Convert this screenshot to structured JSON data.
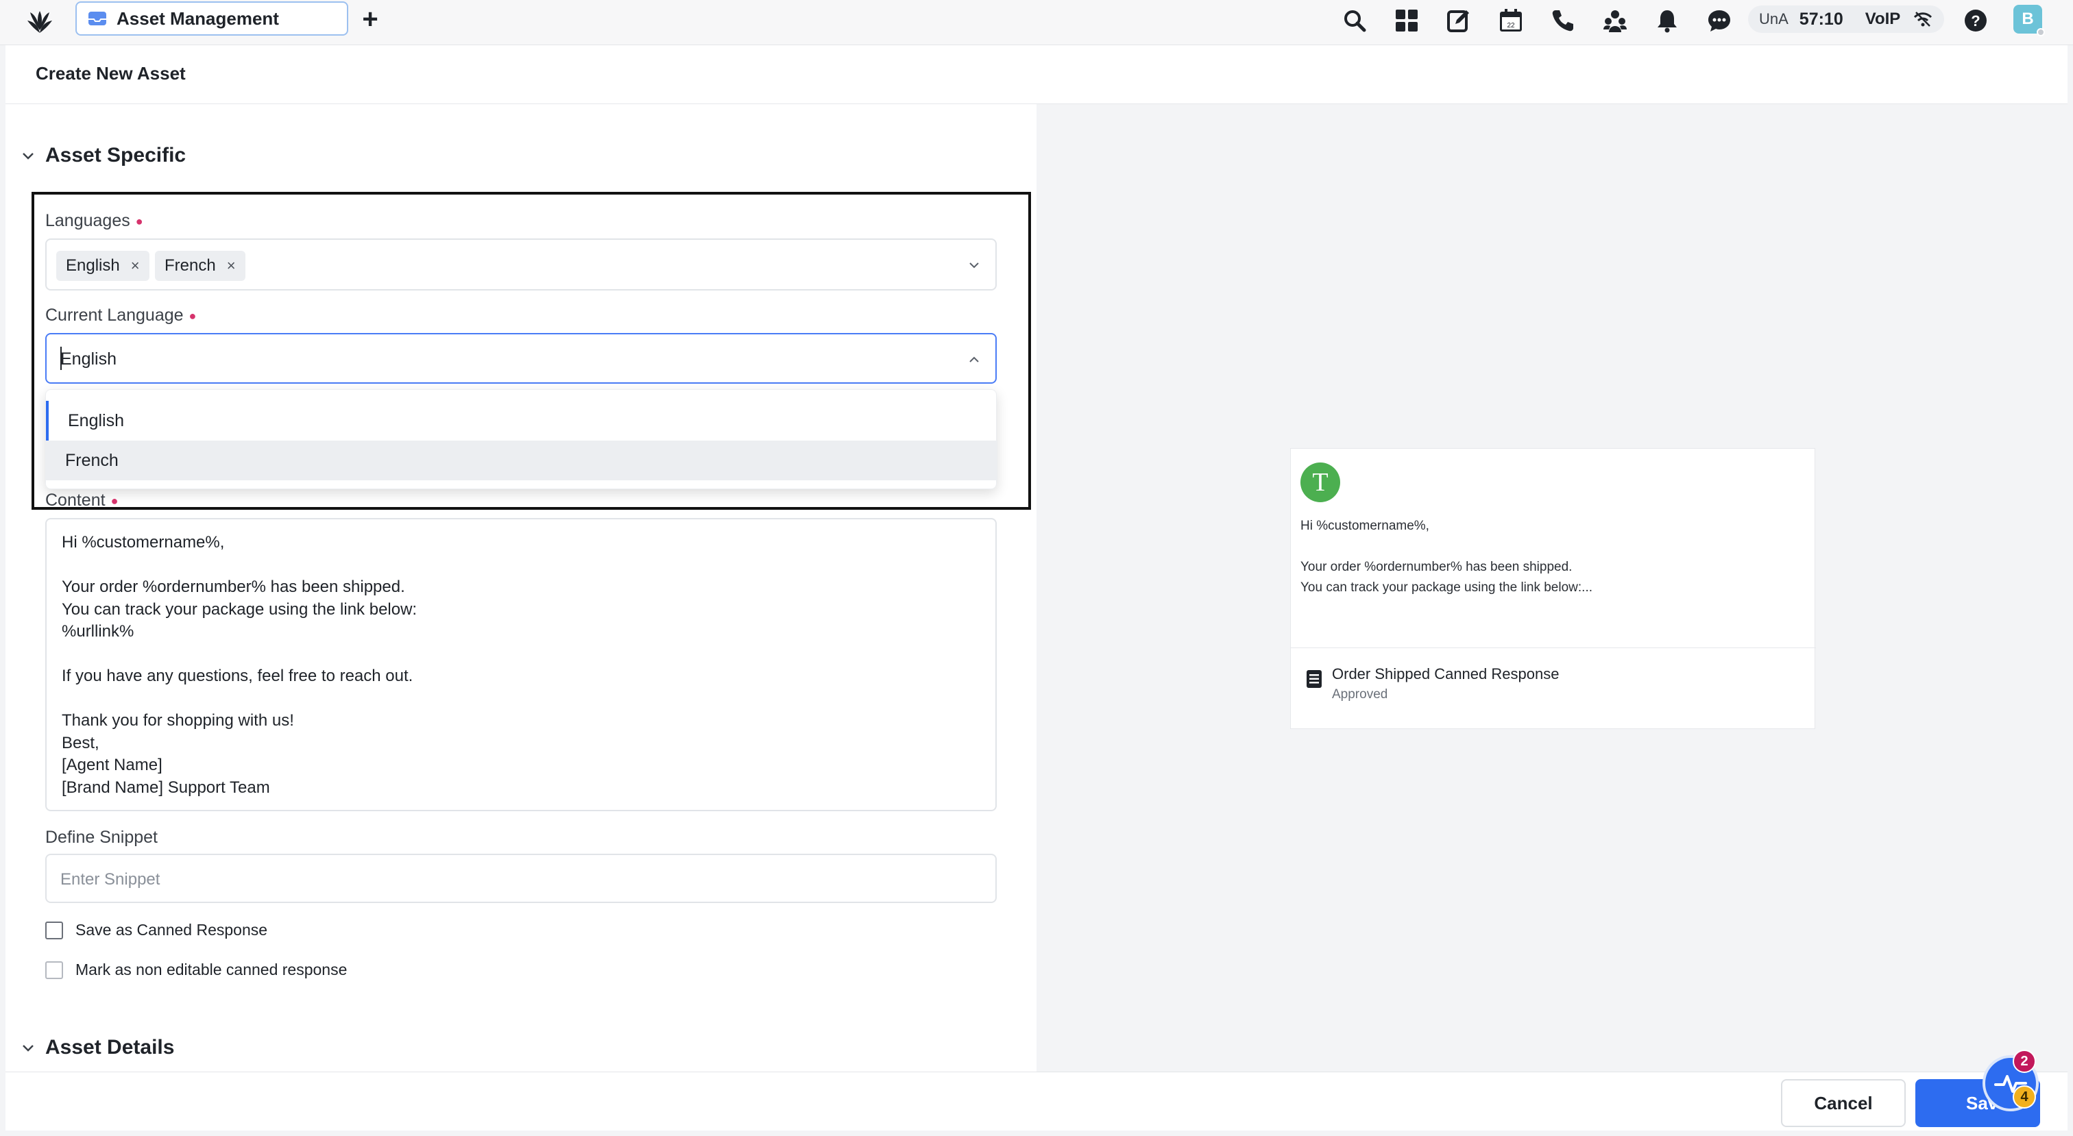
{
  "app_tab": {
    "label": "Asset Management",
    "add_label": "+"
  },
  "status": {
    "una": "UnA",
    "timer": "57:10",
    "voip": "VoIP"
  },
  "user": {
    "initial": "B"
  },
  "header": {
    "title": "Create New Asset"
  },
  "form": {
    "section_specific": "Asset Specific",
    "section_details": "Asset Details",
    "languages": {
      "label": "Languages",
      "chips": [
        "English",
        "French"
      ],
      "remove_glyph": "×"
    },
    "current_language": {
      "label": "Current Language",
      "value": "English",
      "options": [
        "English",
        "French"
      ]
    },
    "content": {
      "label": "Content",
      "value": "Hi %customername%,\n\nYour order %ordernumber% has been shipped.\nYou can track your package using the link below:\n%urllink%\n\nIf you have any questions, feel free to reach out.\n\nThank you for shopping with us!\nBest,\n[Agent Name]\n[Brand Name] Support Team"
    },
    "snippet": {
      "label": "Define Snippet",
      "placeholder": "Enter Snippet"
    },
    "checkboxes": [
      "Save as Canned Response",
      "Mark as non editable canned response"
    ]
  },
  "preview": {
    "avatar": "T",
    "text": "Hi %customername%,\n\nYour order %ordernumber% has been shipped.\nYou can track your package using the link below:...",
    "name": "Order Shipped Canned Response",
    "status": "Approved"
  },
  "footer": {
    "cancel": "Cancel",
    "save": "Save"
  },
  "fab": {
    "badge_red": "2",
    "badge_yellow": "4"
  },
  "colors": {
    "primary": "#2d6cf0",
    "required": "#d6336c",
    "avatar_green": "#4caf50"
  }
}
